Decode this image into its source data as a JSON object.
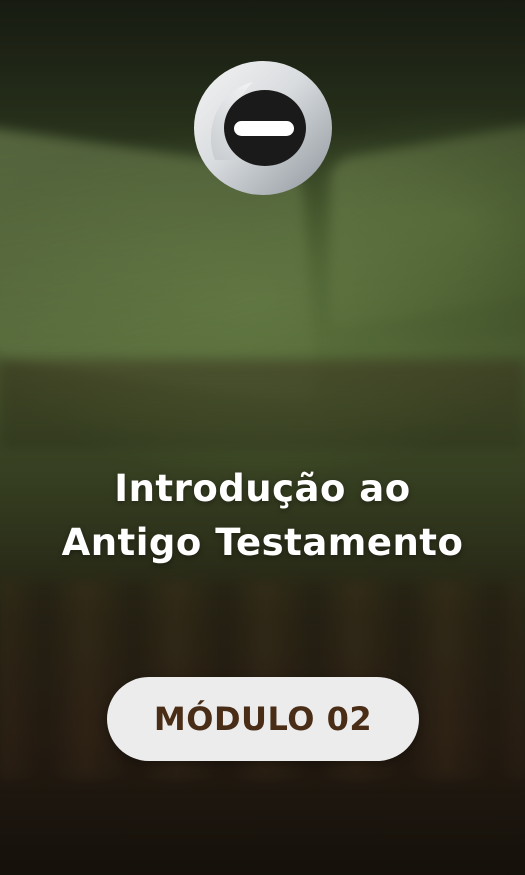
{
  "course": {
    "title_line1": "Introdução ao",
    "title_line2": "Antigo Testamento"
  },
  "module": {
    "label": "MÓDULO 02"
  },
  "logo": {
    "icon": "brand-logo-icon"
  },
  "colors": {
    "title_text": "#ffffff",
    "pill_background": "#ececec",
    "pill_text": "#4a2d16",
    "background_green": "#4a5c30",
    "background_dark": "#1c160e"
  }
}
